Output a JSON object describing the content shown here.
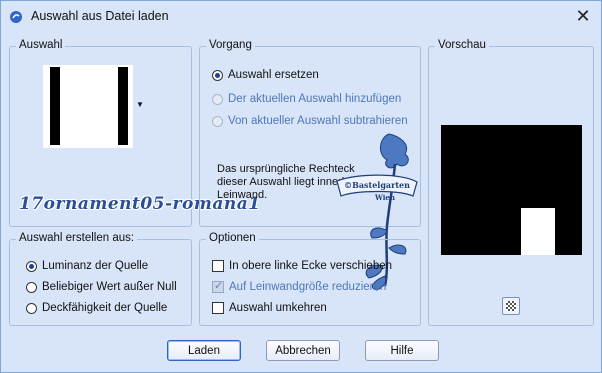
{
  "window": {
    "title": "Auswahl aus Datei laden",
    "close_label": "✕"
  },
  "auswahl": {
    "legend": "Auswahl"
  },
  "vorgang": {
    "legend": "Vorgang",
    "options": [
      {
        "label": "Auswahl ersetzen",
        "selected": true,
        "enabled": true
      },
      {
        "label": "Der aktuellen Auswahl hinzufügen",
        "selected": false,
        "enabled": false
      },
      {
        "label": "Von aktueller Auswahl subtrahieren",
        "selected": false,
        "enabled": false
      }
    ],
    "info": "Das ursprüngliche Rechteck dieser Auswahl liegt innerhalb der Leinwand."
  },
  "vorschau": {
    "legend": "Vorschau",
    "zoom_icon": "checker-icon"
  },
  "erstellen": {
    "legend": "Auswahl erstellen aus:",
    "options": [
      {
        "label": "Luminanz der Quelle",
        "selected": true
      },
      {
        "label": "Beliebiger Wert außer Null",
        "selected": false
      },
      {
        "label": "Deckfähigkeit der Quelle",
        "selected": false
      }
    ]
  },
  "optionen": {
    "legend": "Optionen",
    "items": [
      {
        "label": "In obere linke Ecke verschieben",
        "checked": false,
        "enabled": true
      },
      {
        "label": "Auf Leinwandgröße reduzieren",
        "checked": true,
        "enabled": false
      },
      {
        "label": "Auswahl umkehren",
        "checked": false,
        "enabled": true
      }
    ]
  },
  "buttons": {
    "load": "Laden",
    "cancel": "Abbrechen",
    "help": "Hilfe"
  },
  "watermark": {
    "filename": "17ornament05-romana1",
    "brand": "©Bastelgarten Wien"
  },
  "colors": {
    "background": "#d8e4f8",
    "accent": "#1a3fa0",
    "disabled_text": "#4e78b8",
    "watermark": "#2a4f96"
  }
}
